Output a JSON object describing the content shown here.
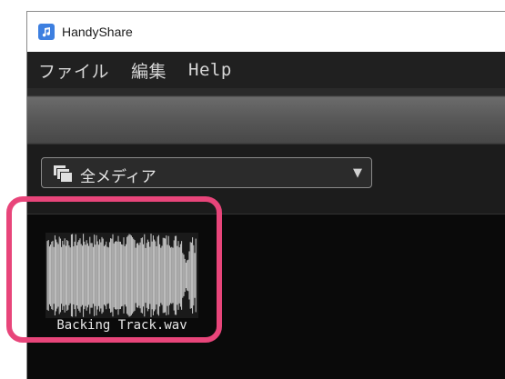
{
  "window": {
    "title": "HandyShare",
    "icon": "handyshare-app-icon"
  },
  "menu": [
    {
      "label": "ファイル"
    },
    {
      "label": "編集"
    },
    {
      "label": "Help"
    }
  ],
  "filter": {
    "selected": "全メディア",
    "icon": "media-stack-icon",
    "arrow": "▼"
  },
  "media_items": [
    {
      "filename": "Backing Track.wav",
      "thumbnail": "waveform"
    }
  ],
  "colors": {
    "highlight": "#e8457a",
    "app_background": "#101010",
    "menu_text": "#d6d6d6"
  }
}
